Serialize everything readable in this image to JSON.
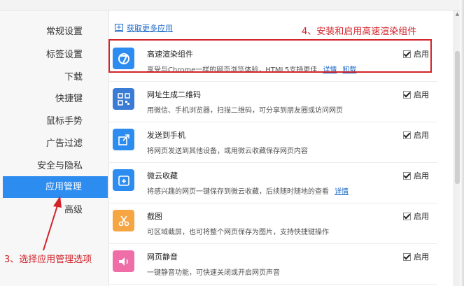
{
  "sidebar": {
    "items": [
      {
        "label": "常规设置",
        "active": false
      },
      {
        "label": "标签设置",
        "active": false
      },
      {
        "label": "下载",
        "active": false
      },
      {
        "label": "快捷键",
        "active": false
      },
      {
        "label": "鼠标手势",
        "active": false
      },
      {
        "label": "广告过滤",
        "active": false
      },
      {
        "label": "安全与隐私",
        "active": false
      },
      {
        "label": "应用管理",
        "active": true
      },
      {
        "label": "高级",
        "active": false
      }
    ]
  },
  "main": {
    "get_more_label": "获取更多应用",
    "apps": [
      {
        "title": "高速渲染组件",
        "desc": "享受与Chrome一样的网页浏览体验，HTML5支持更佳",
        "links": [
          "详情",
          "卸载"
        ],
        "enable_label": "启用",
        "enabled": true,
        "icon": "render-engine-icon",
        "icon_color": "#2d8cf0"
      },
      {
        "title": "网址生成二维码",
        "desc": "用微信、手机浏览器，扫描二维码，可分享到朋友圈或访问网页",
        "links": [],
        "enable_label": "启用",
        "enabled": true,
        "icon": "qr-code-icon",
        "icon_color": "#3a7bd5"
      },
      {
        "title": "发送到手机",
        "desc": "将网页发送到其他设备，或用微云收藏保存网页内容",
        "links": [],
        "enable_label": "启用",
        "enabled": true,
        "icon": "share-icon",
        "icon_color": "#2d8cf0"
      },
      {
        "title": "微云收藏",
        "desc": "将感兴趣的网页一键保存到微云收藏，后续随时随地的查看",
        "links": [
          "详情"
        ],
        "enable_label": "启用",
        "enabled": true,
        "icon": "cloud-bookmark-icon",
        "icon_color": "#2d8cf0"
      },
      {
        "title": "截图",
        "desc": "可区域截屏，也可将整个网页保存为图片，支持快捷键操作",
        "links": [],
        "enable_label": "启用",
        "enabled": true,
        "icon": "scissors-icon",
        "icon_color": "#f5a542"
      },
      {
        "title": "网页静音",
        "desc": "一键静音功能，可快速关闭或开启网页声音",
        "links": [],
        "enable_label": "启用",
        "enabled": true,
        "icon": "speaker-icon",
        "icon_color": "#ef6ea8"
      }
    ]
  },
  "annotations": {
    "top": "4、安装和启用高速渲染组件",
    "bottom": "3、选择应用管理选项"
  },
  "colors": {
    "accent": "#2d8cf0",
    "annotation": "#d2232a",
    "link": "#1a68c8"
  }
}
